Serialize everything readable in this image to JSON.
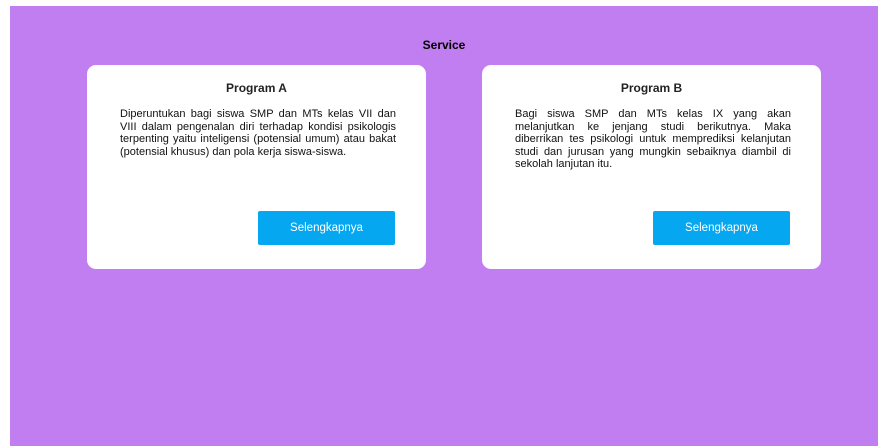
{
  "section": {
    "title": "Service"
  },
  "cards": [
    {
      "title": "Program A",
      "description": "Diperuntukan bagi siswa SMP dan MTs kelas VII dan VIII dalam pengenalan diri terhadap kondisi psikologis terpenting yaitu inteligensi (potensial umum) atau bakat (potensial khusus) dan pola kerja  siswa-siswa.",
      "button_label": "Selengkapnya"
    },
    {
      "title": "Program B",
      "description": "Bagi siswa SMP dan MTs kelas IX yang akan melanjutkan ke jenjang studi berikutnya. Maka diberrikan tes psikologi untuk memprediksi kelanjutan studi dan jurusan yang mungkin sebaiknya diambil di sekolah lanjutan itu.",
      "button_label": "Selengkapnya"
    }
  ],
  "colors": {
    "background": "#c17ef0",
    "card": "#ffffff",
    "button": "#05a7f0",
    "button_text": "#ffffff"
  }
}
